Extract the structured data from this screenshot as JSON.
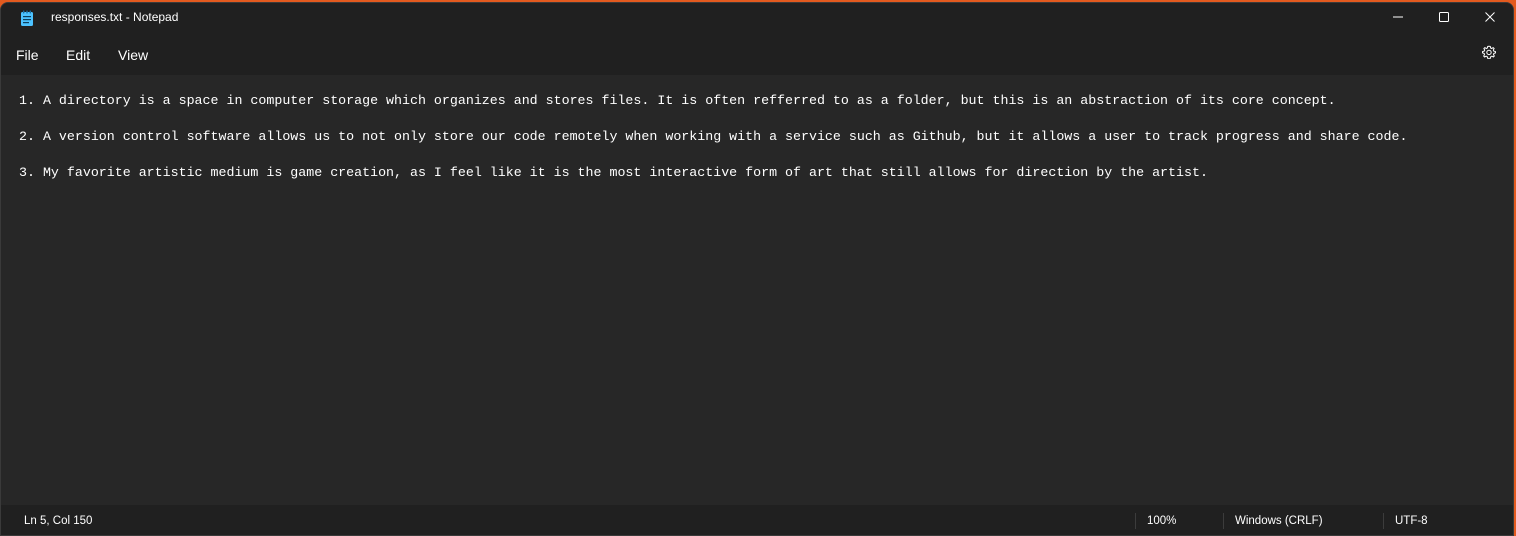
{
  "window": {
    "title": "responses.txt - Notepad",
    "app_icon": "notepad-icon",
    "controls": {
      "minimize_icon": "minimize-icon",
      "maximize_icon": "maximize-icon",
      "close_icon": "close-icon"
    }
  },
  "menu": {
    "file": "File",
    "edit": "Edit",
    "view": "View",
    "settings_icon": "gear-icon"
  },
  "editor": {
    "lines": [
      "1. A directory is a space in computer storage which organizes and stores files. It is often refferred to as a folder, but this is an abstraction of its core concept.",
      "",
      "2. A version control software allows us to not only store our code remotely when working with a service such as Github, but it allows a user to track progress and share code.",
      "",
      "3. My favorite artistic medium is game creation, as I feel like it is the most interactive form of art that still allows for direction by the artist."
    ]
  },
  "status": {
    "position": "Ln 5, Col 150",
    "zoom": "100%",
    "line_ending": "Windows (CRLF)",
    "encoding": "UTF-8"
  },
  "colors": {
    "background": "#202020",
    "editor_background": "#272727",
    "text": "#ffffff",
    "desktop_accent": "#e35a1f",
    "icon_accent": "#4cc2ff"
  }
}
